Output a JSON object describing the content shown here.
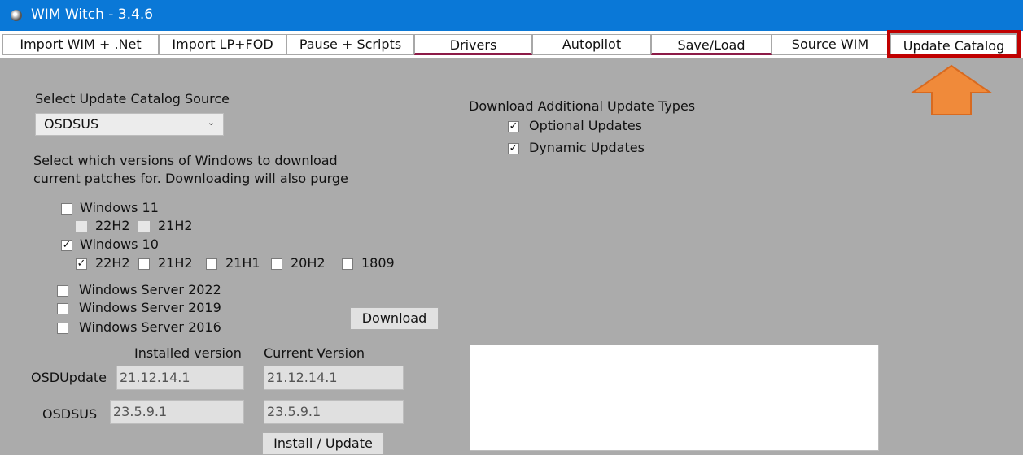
{
  "window": {
    "title": "WIM Witch - 3.4.6"
  },
  "tabs": [
    {
      "label": "Import WIM + .Net"
    },
    {
      "label": "Import LP+FOD"
    },
    {
      "label": "Pause + Scripts"
    },
    {
      "label": "Drivers"
    },
    {
      "label": "Autopilot"
    },
    {
      "label": "Save/Load"
    },
    {
      "label": "Source WIM"
    },
    {
      "label": "Update Catalog"
    }
  ],
  "source": {
    "label": "Select Update Catalog Source",
    "selected": "OSDSUS"
  },
  "versions_prompt": {
    "line1": "Select which versions of Windows to download",
    "line2": "current patches for. Downloading will also purge"
  },
  "windows11": {
    "label": "Windows 11",
    "checked": false,
    "builds": [
      {
        "label": "22H2",
        "checked": false
      },
      {
        "label": "21H2",
        "checked": false
      }
    ]
  },
  "windows10": {
    "label": "Windows 10",
    "checked": true,
    "builds": [
      {
        "label": "22H2",
        "checked": true
      },
      {
        "label": "21H2",
        "checked": false
      },
      {
        "label": "21H1",
        "checked": false
      },
      {
        "label": "20H2",
        "checked": false
      },
      {
        "label": "1809",
        "checked": false
      }
    ]
  },
  "servers": [
    {
      "label": "Windows Server 2022",
      "checked": false
    },
    {
      "label": "Windows Server 2019",
      "checked": false
    },
    {
      "label": "Windows Server 2016",
      "checked": false
    }
  ],
  "download_button": "Download",
  "additional": {
    "label": "Download Additional Update Types",
    "optional": {
      "label": "Optional Updates",
      "checked": true
    },
    "dynamic": {
      "label": "Dynamic Updates",
      "checked": true
    }
  },
  "version_table": {
    "installed_header": "Installed version",
    "current_header": "Current Version",
    "rows": [
      {
        "label": "OSDUpdate",
        "installed": "21.12.14.1",
        "current": "21.12.14.1"
      },
      {
        "label": "OSDSUS",
        "installed": "23.5.9.1",
        "current": "23.5.9.1"
      }
    ]
  },
  "install_button": "Install / Update",
  "glyphs": {
    "check": "✓",
    "chevron": "⌄"
  },
  "colors": {
    "titlebar": "#0a78d7",
    "tab_accent": "#8c1b47",
    "highlight_box": "#c00000",
    "arrow": "#f08a3a",
    "panel": "#ababab"
  }
}
